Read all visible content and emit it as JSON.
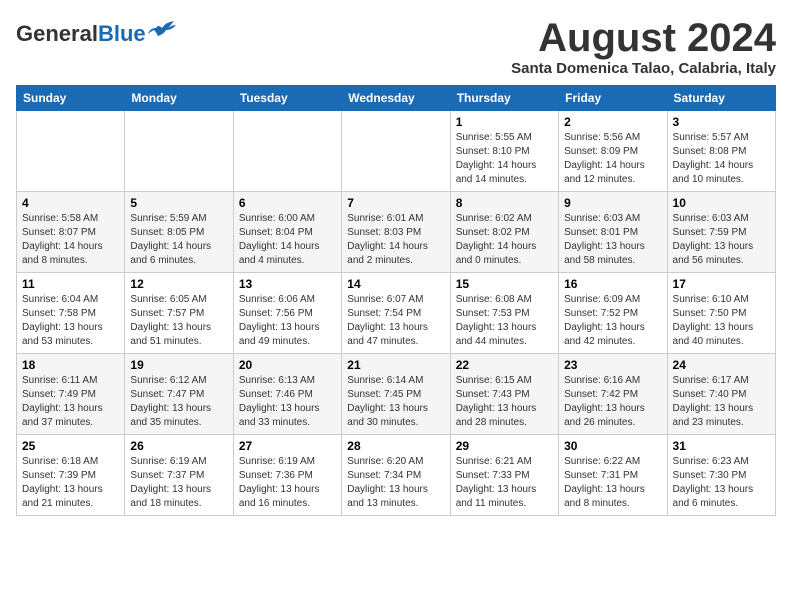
{
  "header": {
    "logo_line1": "General",
    "logo_line2": "Blue",
    "month_year": "August 2024",
    "location": "Santa Domenica Talao, Calabria, Italy"
  },
  "weekdays": [
    "Sunday",
    "Monday",
    "Tuesday",
    "Wednesday",
    "Thursday",
    "Friday",
    "Saturday"
  ],
  "weeks": [
    [
      {
        "day": "",
        "info": ""
      },
      {
        "day": "",
        "info": ""
      },
      {
        "day": "",
        "info": ""
      },
      {
        "day": "",
        "info": ""
      },
      {
        "day": "1",
        "info": "Sunrise: 5:55 AM\nSunset: 8:10 PM\nDaylight: 14 hours\nand 14 minutes."
      },
      {
        "day": "2",
        "info": "Sunrise: 5:56 AM\nSunset: 8:09 PM\nDaylight: 14 hours\nand 12 minutes."
      },
      {
        "day": "3",
        "info": "Sunrise: 5:57 AM\nSunset: 8:08 PM\nDaylight: 14 hours\nand 10 minutes."
      }
    ],
    [
      {
        "day": "4",
        "info": "Sunrise: 5:58 AM\nSunset: 8:07 PM\nDaylight: 14 hours\nand 8 minutes."
      },
      {
        "day": "5",
        "info": "Sunrise: 5:59 AM\nSunset: 8:05 PM\nDaylight: 14 hours\nand 6 minutes."
      },
      {
        "day": "6",
        "info": "Sunrise: 6:00 AM\nSunset: 8:04 PM\nDaylight: 14 hours\nand 4 minutes."
      },
      {
        "day": "7",
        "info": "Sunrise: 6:01 AM\nSunset: 8:03 PM\nDaylight: 14 hours\nand 2 minutes."
      },
      {
        "day": "8",
        "info": "Sunrise: 6:02 AM\nSunset: 8:02 PM\nDaylight: 14 hours\nand 0 minutes."
      },
      {
        "day": "9",
        "info": "Sunrise: 6:03 AM\nSunset: 8:01 PM\nDaylight: 13 hours\nand 58 minutes."
      },
      {
        "day": "10",
        "info": "Sunrise: 6:03 AM\nSunset: 7:59 PM\nDaylight: 13 hours\nand 56 minutes."
      }
    ],
    [
      {
        "day": "11",
        "info": "Sunrise: 6:04 AM\nSunset: 7:58 PM\nDaylight: 13 hours\nand 53 minutes."
      },
      {
        "day": "12",
        "info": "Sunrise: 6:05 AM\nSunset: 7:57 PM\nDaylight: 13 hours\nand 51 minutes."
      },
      {
        "day": "13",
        "info": "Sunrise: 6:06 AM\nSunset: 7:56 PM\nDaylight: 13 hours\nand 49 minutes."
      },
      {
        "day": "14",
        "info": "Sunrise: 6:07 AM\nSunset: 7:54 PM\nDaylight: 13 hours\nand 47 minutes."
      },
      {
        "day": "15",
        "info": "Sunrise: 6:08 AM\nSunset: 7:53 PM\nDaylight: 13 hours\nand 44 minutes."
      },
      {
        "day": "16",
        "info": "Sunrise: 6:09 AM\nSunset: 7:52 PM\nDaylight: 13 hours\nand 42 minutes."
      },
      {
        "day": "17",
        "info": "Sunrise: 6:10 AM\nSunset: 7:50 PM\nDaylight: 13 hours\nand 40 minutes."
      }
    ],
    [
      {
        "day": "18",
        "info": "Sunrise: 6:11 AM\nSunset: 7:49 PM\nDaylight: 13 hours\nand 37 minutes."
      },
      {
        "day": "19",
        "info": "Sunrise: 6:12 AM\nSunset: 7:47 PM\nDaylight: 13 hours\nand 35 minutes."
      },
      {
        "day": "20",
        "info": "Sunrise: 6:13 AM\nSunset: 7:46 PM\nDaylight: 13 hours\nand 33 minutes."
      },
      {
        "day": "21",
        "info": "Sunrise: 6:14 AM\nSunset: 7:45 PM\nDaylight: 13 hours\nand 30 minutes."
      },
      {
        "day": "22",
        "info": "Sunrise: 6:15 AM\nSunset: 7:43 PM\nDaylight: 13 hours\nand 28 minutes."
      },
      {
        "day": "23",
        "info": "Sunrise: 6:16 AM\nSunset: 7:42 PM\nDaylight: 13 hours\nand 26 minutes."
      },
      {
        "day": "24",
        "info": "Sunrise: 6:17 AM\nSunset: 7:40 PM\nDaylight: 13 hours\nand 23 minutes."
      }
    ],
    [
      {
        "day": "25",
        "info": "Sunrise: 6:18 AM\nSunset: 7:39 PM\nDaylight: 13 hours\nand 21 minutes."
      },
      {
        "day": "26",
        "info": "Sunrise: 6:19 AM\nSunset: 7:37 PM\nDaylight: 13 hours\nand 18 minutes."
      },
      {
        "day": "27",
        "info": "Sunrise: 6:19 AM\nSunset: 7:36 PM\nDaylight: 13 hours\nand 16 minutes."
      },
      {
        "day": "28",
        "info": "Sunrise: 6:20 AM\nSunset: 7:34 PM\nDaylight: 13 hours\nand 13 minutes."
      },
      {
        "day": "29",
        "info": "Sunrise: 6:21 AM\nSunset: 7:33 PM\nDaylight: 13 hours\nand 11 minutes."
      },
      {
        "day": "30",
        "info": "Sunrise: 6:22 AM\nSunset: 7:31 PM\nDaylight: 13 hours\nand 8 minutes."
      },
      {
        "day": "31",
        "info": "Sunrise: 6:23 AM\nSunset: 7:30 PM\nDaylight: 13 hours\nand 6 minutes."
      }
    ]
  ]
}
